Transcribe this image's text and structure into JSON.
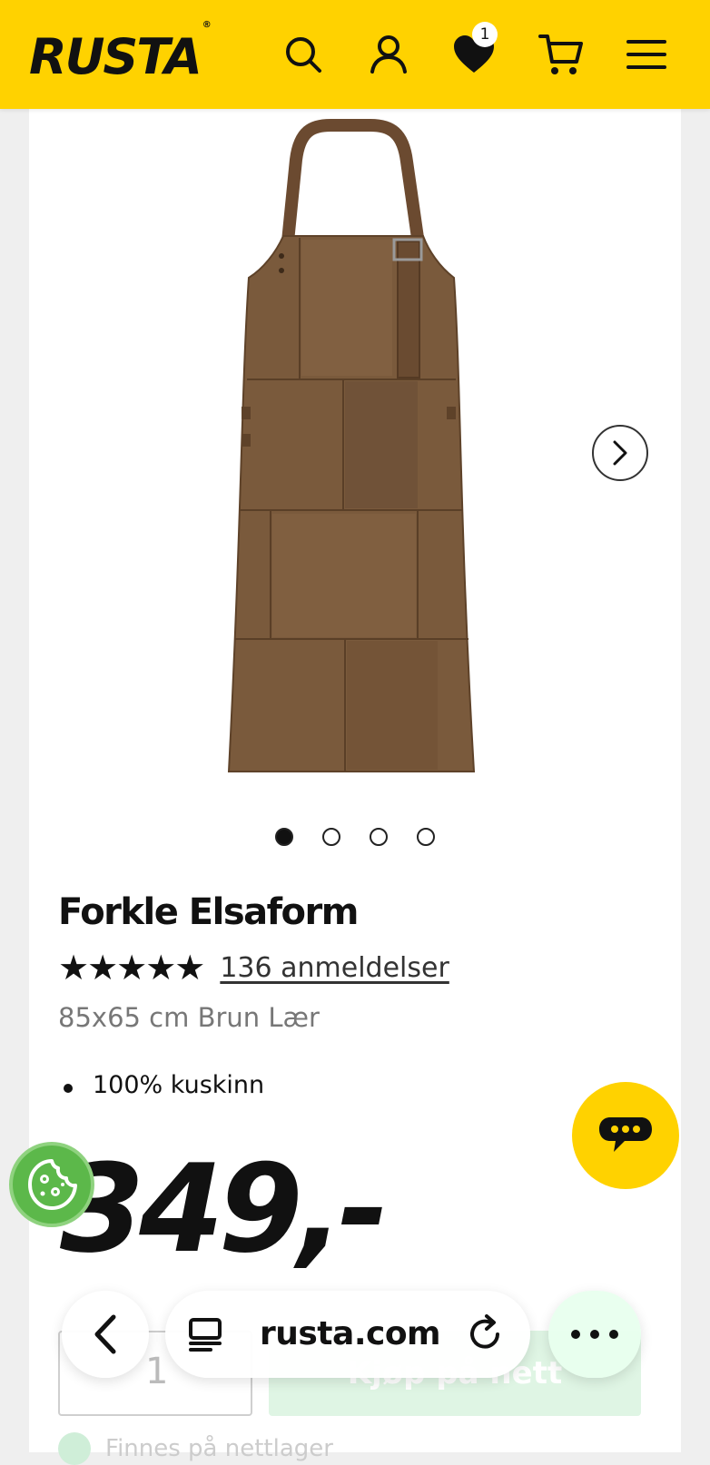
{
  "header": {
    "logo": "RUSTA",
    "logo_mark": "®",
    "wishlist_count": "1",
    "icons": [
      "search-icon",
      "account-icon",
      "heart-icon",
      "cart-icon",
      "menu-icon"
    ]
  },
  "gallery": {
    "image_count": 4,
    "active_index": 0
  },
  "product": {
    "title": "Forkle Elsaform",
    "rating_stars": "★★★★★",
    "reviews_label": "136 anmeldelser",
    "subtitle": "85x65 cm Brun Lær",
    "features": [
      "100% kuskinn"
    ],
    "price": "349,-"
  },
  "purchase": {
    "quantity": "1",
    "buy_label": "Kjøp på nett",
    "stock_label": "Finnes på nettlager"
  },
  "browser": {
    "url": "rusta.com"
  },
  "colors": {
    "brand_yellow": "#ffd200",
    "text_dark": "#111111",
    "cookie_green": "#5cb84a",
    "buy_green": "#dff5e4",
    "leather_brown": "#7a5a3c"
  }
}
